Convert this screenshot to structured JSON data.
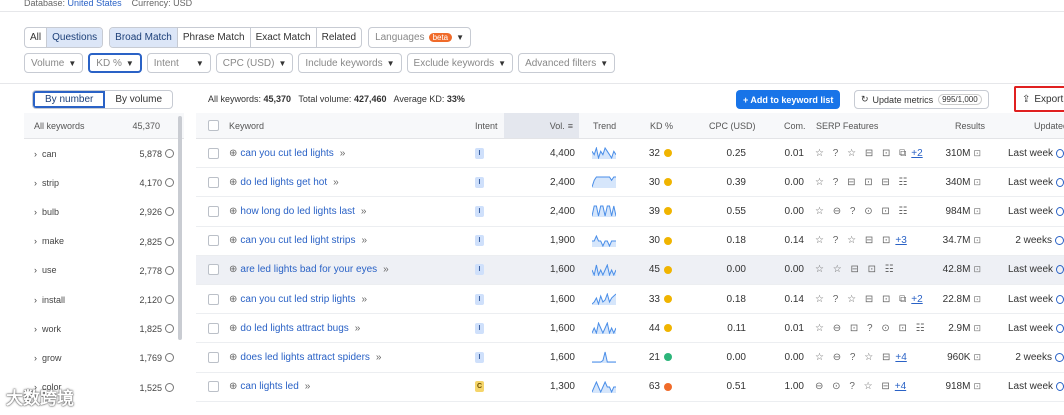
{
  "top": {
    "database_label": "Database:",
    "database_value": "United States",
    "currency_label": "Currency: USD"
  },
  "row1": {
    "all": "All",
    "questions": "Questions",
    "match": [
      "Broad Match",
      "Phrase Match",
      "Exact Match",
      "Related"
    ],
    "languages": "Languages",
    "beta": "beta"
  },
  "filters": [
    "Volume",
    "KD %",
    "Intent",
    "CPC (USD)",
    "Include keywords",
    "Exclude keywords",
    "Advanced filters"
  ],
  "toolbar": {
    "by_number": "By number",
    "by_volume": "By volume",
    "all_keywords_label": "All keywords:",
    "all_keywords_value": "45,370",
    "total_volume_label": "Total volume:",
    "total_volume_value": "427,460",
    "avg_kd_label": "Average KD:",
    "avg_kd_value": "33%",
    "add_button": "+ Add to keyword list",
    "update_button": "Update metrics",
    "update_count": "995/1,000",
    "export_button": "Export"
  },
  "sidebar": {
    "header_label": "All keywords",
    "header_count": "45,370",
    "items": [
      {
        "label": "can",
        "count": "5,878"
      },
      {
        "label": "strip",
        "count": "4,170"
      },
      {
        "label": "bulb",
        "count": "2,926"
      },
      {
        "label": "make",
        "count": "2,825"
      },
      {
        "label": "use",
        "count": "2,778"
      },
      {
        "label": "install",
        "count": "2,120"
      },
      {
        "label": "work",
        "count": "1,825"
      },
      {
        "label": "grow",
        "count": "1,769"
      },
      {
        "label": "color",
        "count": "1,525"
      }
    ]
  },
  "columns": {
    "keyword": "Keyword",
    "intent": "Intent",
    "vol": "Vol.",
    "trend": "Trend",
    "kd": "KD %",
    "cpc": "CPC (USD)",
    "com": "Com.",
    "serp": "SERP Features",
    "results": "Results",
    "updated": "Updated"
  },
  "rows": [
    {
      "keyword": "can you cut led lights",
      "intent": "I",
      "vol": "4,400",
      "kd": "32",
      "kd_color": "#f0b400",
      "cpc": "0.25",
      "com": "0.01",
      "serp": "☆ ? ☆ ⊟ ⊡ ⧉",
      "serp_more": "+2",
      "results": "310M",
      "updated": "Last week",
      "trend": [
        5,
        4,
        6,
        3,
        5,
        4,
        6,
        5,
        4,
        3,
        5,
        4
      ]
    },
    {
      "keyword": "do led lights get hot",
      "intent": "I",
      "vol": "2,400",
      "kd": "30",
      "kd_color": "#f0b400",
      "cpc": "0.39",
      "com": "0.00",
      "serp": "☆ ? ⊟ ⊡ ⊟ ☷",
      "serp_more": "",
      "results": "340M",
      "updated": "Last week",
      "trend": [
        3,
        5,
        6,
        6,
        6,
        6,
        6,
        6,
        6,
        5,
        6,
        6
      ]
    },
    {
      "keyword": "how long do led lights last",
      "intent": "I",
      "vol": "2,400",
      "kd": "39",
      "kd_color": "#f0b400",
      "cpc": "0.55",
      "com": "0.00",
      "serp": "☆ ⊖ ? ⊙ ⊡ ☷",
      "serp_more": "",
      "results": "984M",
      "updated": "Last week",
      "trend": [
        5,
        6,
        6,
        5,
        6,
        6,
        5,
        6,
        6,
        5,
        6,
        5
      ]
    },
    {
      "keyword": "can you cut led light strips",
      "intent": "I",
      "vol": "1,900",
      "kd": "30",
      "kd_color": "#f0b400",
      "cpc": "0.18",
      "com": "0.14",
      "serp": "☆ ? ☆ ⊟ ⊡",
      "serp_more": "+3",
      "results": "34.7M",
      "updated": "2 weeks",
      "trend": [
        3,
        3,
        4,
        3,
        3,
        2,
        3,
        3,
        2,
        3,
        3,
        3
      ]
    },
    {
      "keyword": "are led lights bad for your eyes",
      "intent": "I",
      "vol": "1,600",
      "kd": "45",
      "kd_color": "#f0b400",
      "cpc": "0.00",
      "com": "0.00",
      "serp": "☆ ☆ ⊟ ⊡ ☷",
      "serp_more": "",
      "results": "42.8M",
      "updated": "Last week",
      "trend": [
        3,
        2,
        4,
        2,
        3,
        2,
        3,
        4,
        2,
        3,
        2,
        3
      ]
    },
    {
      "keyword": "can you cut led strip lights",
      "intent": "I",
      "vol": "1,600",
      "kd": "33",
      "kd_color": "#f0b400",
      "cpc": "0.18",
      "com": "0.14",
      "serp": "☆ ? ☆ ⊟ ⊡ ⧉",
      "serp_more": "+2",
      "results": "22.8M",
      "updated": "Last week",
      "trend": [
        2,
        3,
        5,
        2,
        6,
        3,
        4,
        7,
        3,
        5,
        6,
        7
      ]
    },
    {
      "keyword": "do led lights attract bugs",
      "intent": "I",
      "vol": "1,600",
      "kd": "44",
      "kd_color": "#f0b400",
      "cpc": "0.11",
      "com": "0.01",
      "serp": "☆ ⊖ ⊡ ? ⊙ ⊡ ☷",
      "serp_more": "",
      "results": "2.9M",
      "updated": "Last week",
      "trend": [
        3,
        4,
        3,
        5,
        4,
        3,
        4,
        5,
        3,
        4,
        3,
        4
      ]
    },
    {
      "keyword": "does led lights attract spiders",
      "intent": "I",
      "vol": "1,600",
      "kd": "21",
      "kd_color": "#2cb57a",
      "cpc": "0.00",
      "com": "0.00",
      "serp": "☆ ⊖ ? ☆ ⊟",
      "serp_more": "+4",
      "results": "960K",
      "updated": "2 weeks",
      "trend": [
        1,
        1,
        1,
        1,
        1,
        2,
        8,
        1,
        1,
        1,
        1,
        1
      ]
    },
    {
      "keyword": "can lights led",
      "intent": "C",
      "vol": "1,300",
      "kd": "63",
      "kd_color": "#f06b2a",
      "cpc": "0.51",
      "com": "1.00",
      "serp": "⊖ ⊙ ? ☆ ⊟",
      "serp_more": "+4",
      "results": "918M",
      "updated": "Last week",
      "trend": [
        3,
        4,
        5,
        4,
        3,
        4,
        5,
        4,
        4,
        3,
        4,
        4
      ]
    }
  ],
  "watermark": "大数跨境"
}
